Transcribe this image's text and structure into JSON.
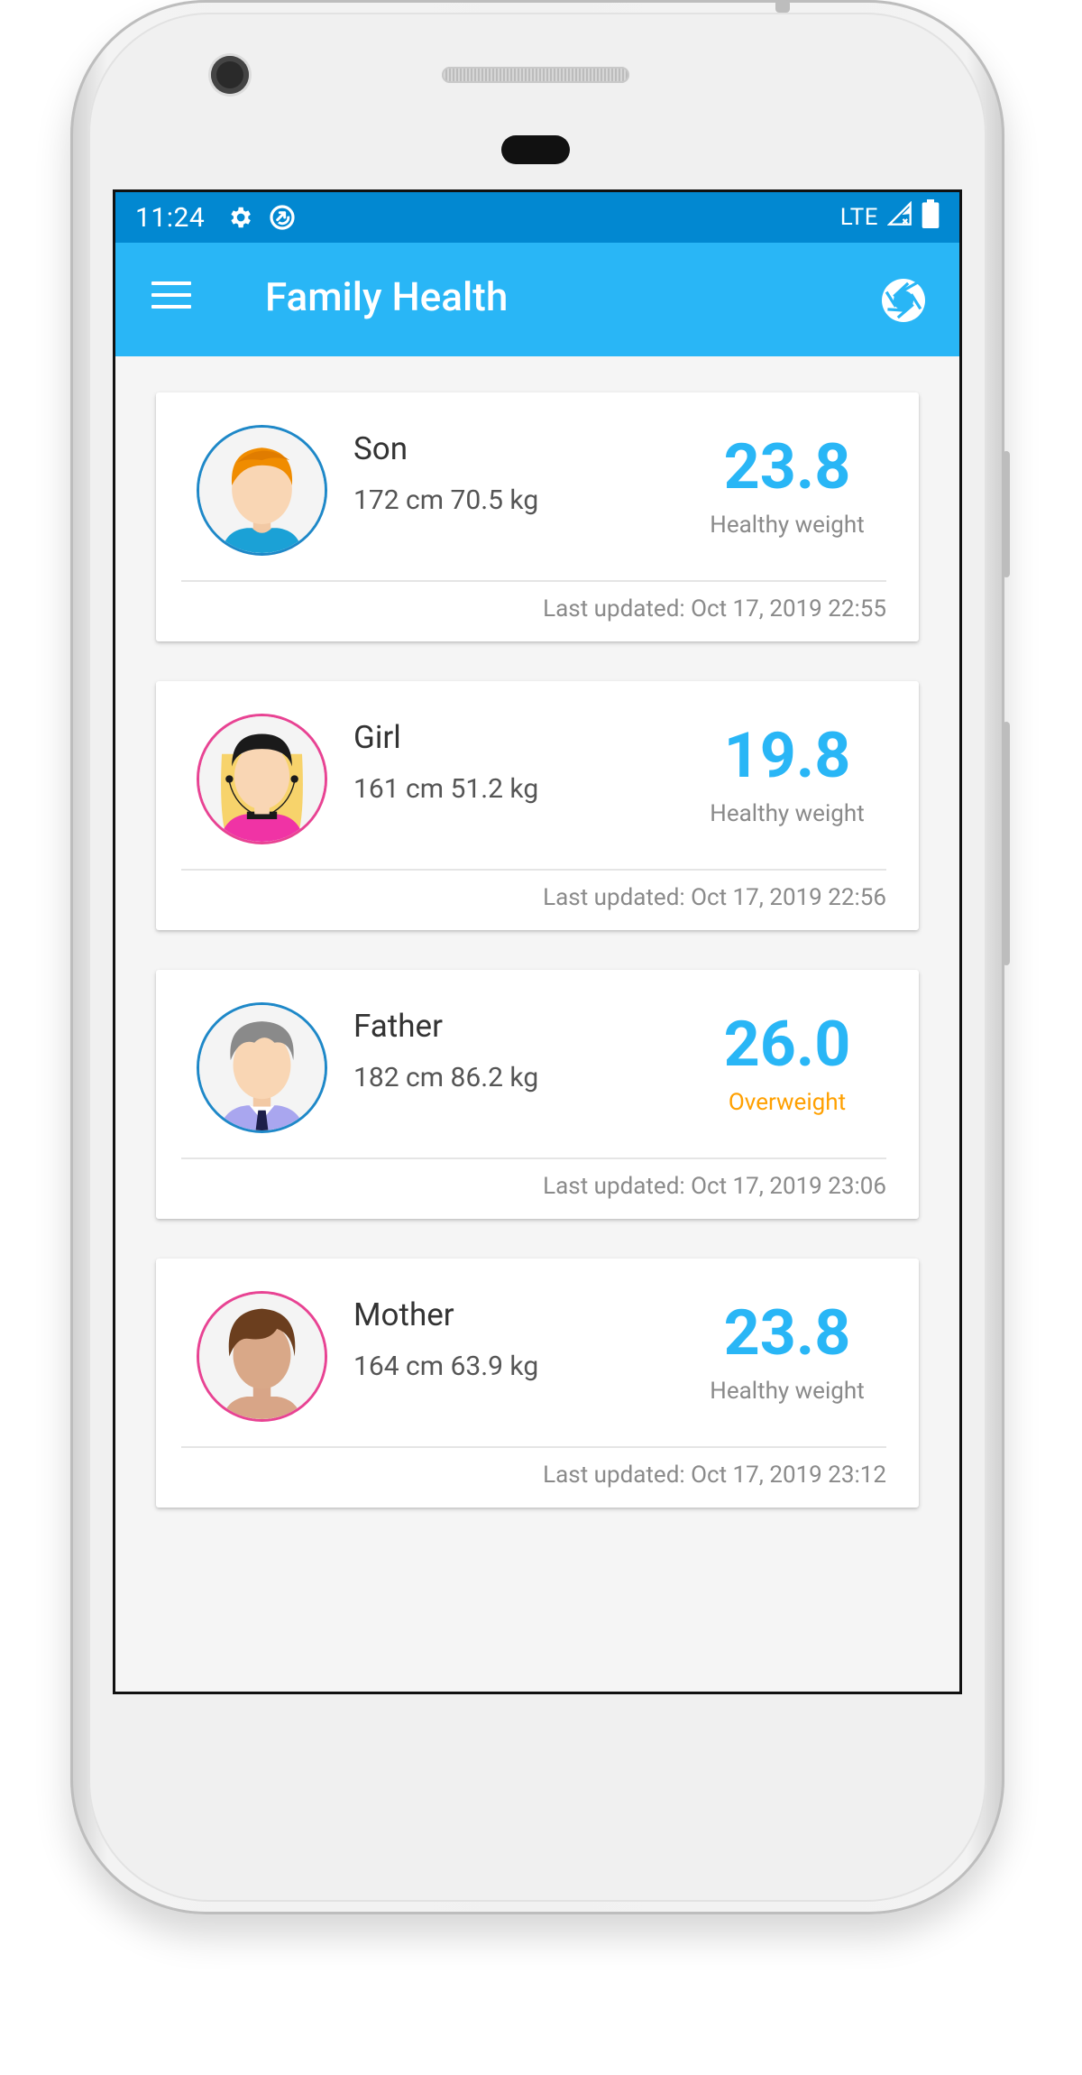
{
  "status_bar": {
    "time": "11:24",
    "left_icons": [
      "gear-icon",
      "sync-icon"
    ],
    "network": "LTE",
    "right_icons": [
      "signal-icon",
      "battery-icon"
    ]
  },
  "app_bar": {
    "title": "Family Health",
    "left_icon": "menu-icon",
    "right_icon": "camera-shutter-icon"
  },
  "colors": {
    "status_bar": "#0288d1",
    "app_bar": "#29b6f6",
    "bmi": "#29b6f6",
    "overweight": "#ffa000"
  },
  "members": [
    {
      "name": "Son",
      "stats": "172 cm 70.5 kg",
      "bmi": "23.8",
      "status": "Healthy weight",
      "updated": "Last updated: Oct 17, 2019 22:55"
    },
    {
      "name": "Girl",
      "stats": "161 cm 51.2 kg",
      "bmi": "19.8",
      "status": "Healthy weight",
      "updated": "Last updated: Oct 17, 2019 22:56"
    },
    {
      "name": "Father",
      "stats": "182 cm 86.2 kg",
      "bmi": "26.0",
      "status": "Overweight",
      "updated": "Last updated: Oct 17, 2019 23:06"
    },
    {
      "name": "Mother",
      "stats": "164 cm 63.9 kg",
      "bmi": "23.8",
      "status": "Healthy weight",
      "updated": "Last updated: Oct 17, 2019 23:12"
    }
  ]
}
